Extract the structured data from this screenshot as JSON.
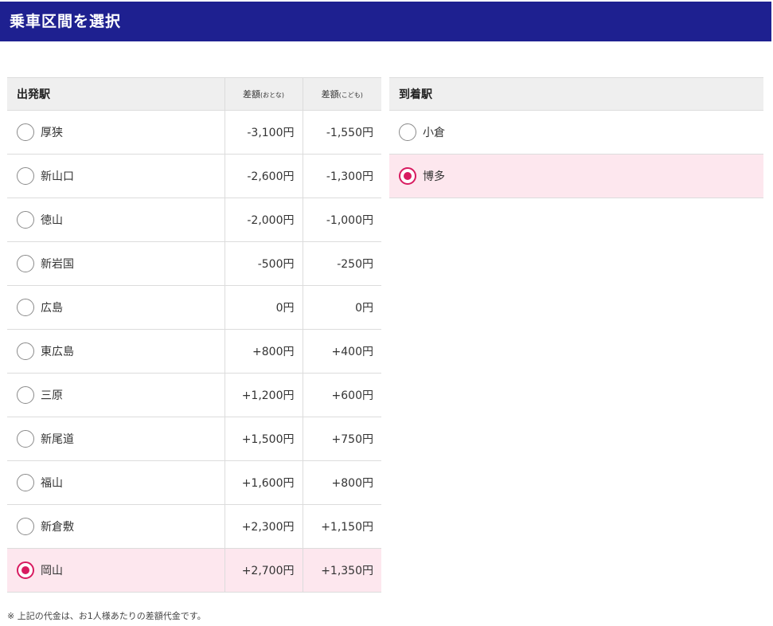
{
  "header": {
    "title": "乗車区間を選択"
  },
  "departure": {
    "col_station": "出発駅",
    "col_adult": "差額",
    "col_adult_sub": "(おとな)",
    "col_child": "差額",
    "col_child_sub": "(こども)",
    "rows": [
      {
        "station": "厚狭",
        "adult": "-3,100円",
        "child": "-1,550円",
        "selected": false
      },
      {
        "station": "新山口",
        "adult": "-2,600円",
        "child": "-1,300円",
        "selected": false
      },
      {
        "station": "徳山",
        "adult": "-2,000円",
        "child": "-1,000円",
        "selected": false
      },
      {
        "station": "新岩国",
        "adult": "-500円",
        "child": "-250円",
        "selected": false
      },
      {
        "station": "広島",
        "adult": "0円",
        "child": "0円",
        "selected": false
      },
      {
        "station": "東広島",
        "adult": "+800円",
        "child": "+400円",
        "selected": false
      },
      {
        "station": "三原",
        "adult": "+1,200円",
        "child": "+600円",
        "selected": false
      },
      {
        "station": "新尾道",
        "adult": "+1,500円",
        "child": "+750円",
        "selected": false
      },
      {
        "station": "福山",
        "adult": "+1,600円",
        "child": "+800円",
        "selected": false
      },
      {
        "station": "新倉敷",
        "adult": "+2,300円",
        "child": "+1,150円",
        "selected": false
      },
      {
        "station": "岡山",
        "adult": "+2,700円",
        "child": "+1,350円",
        "selected": true
      }
    ]
  },
  "arrival": {
    "col_station": "到着駅",
    "rows": [
      {
        "station": "小倉",
        "selected": false
      },
      {
        "station": "博多",
        "selected": true
      }
    ]
  },
  "note": "※ 上記の代金は、お1人様あたりの差額代金です。",
  "colors": {
    "header_bg": "#1e2090",
    "accent": "#d81b60",
    "selected_row_bg": "#fde7ee"
  }
}
